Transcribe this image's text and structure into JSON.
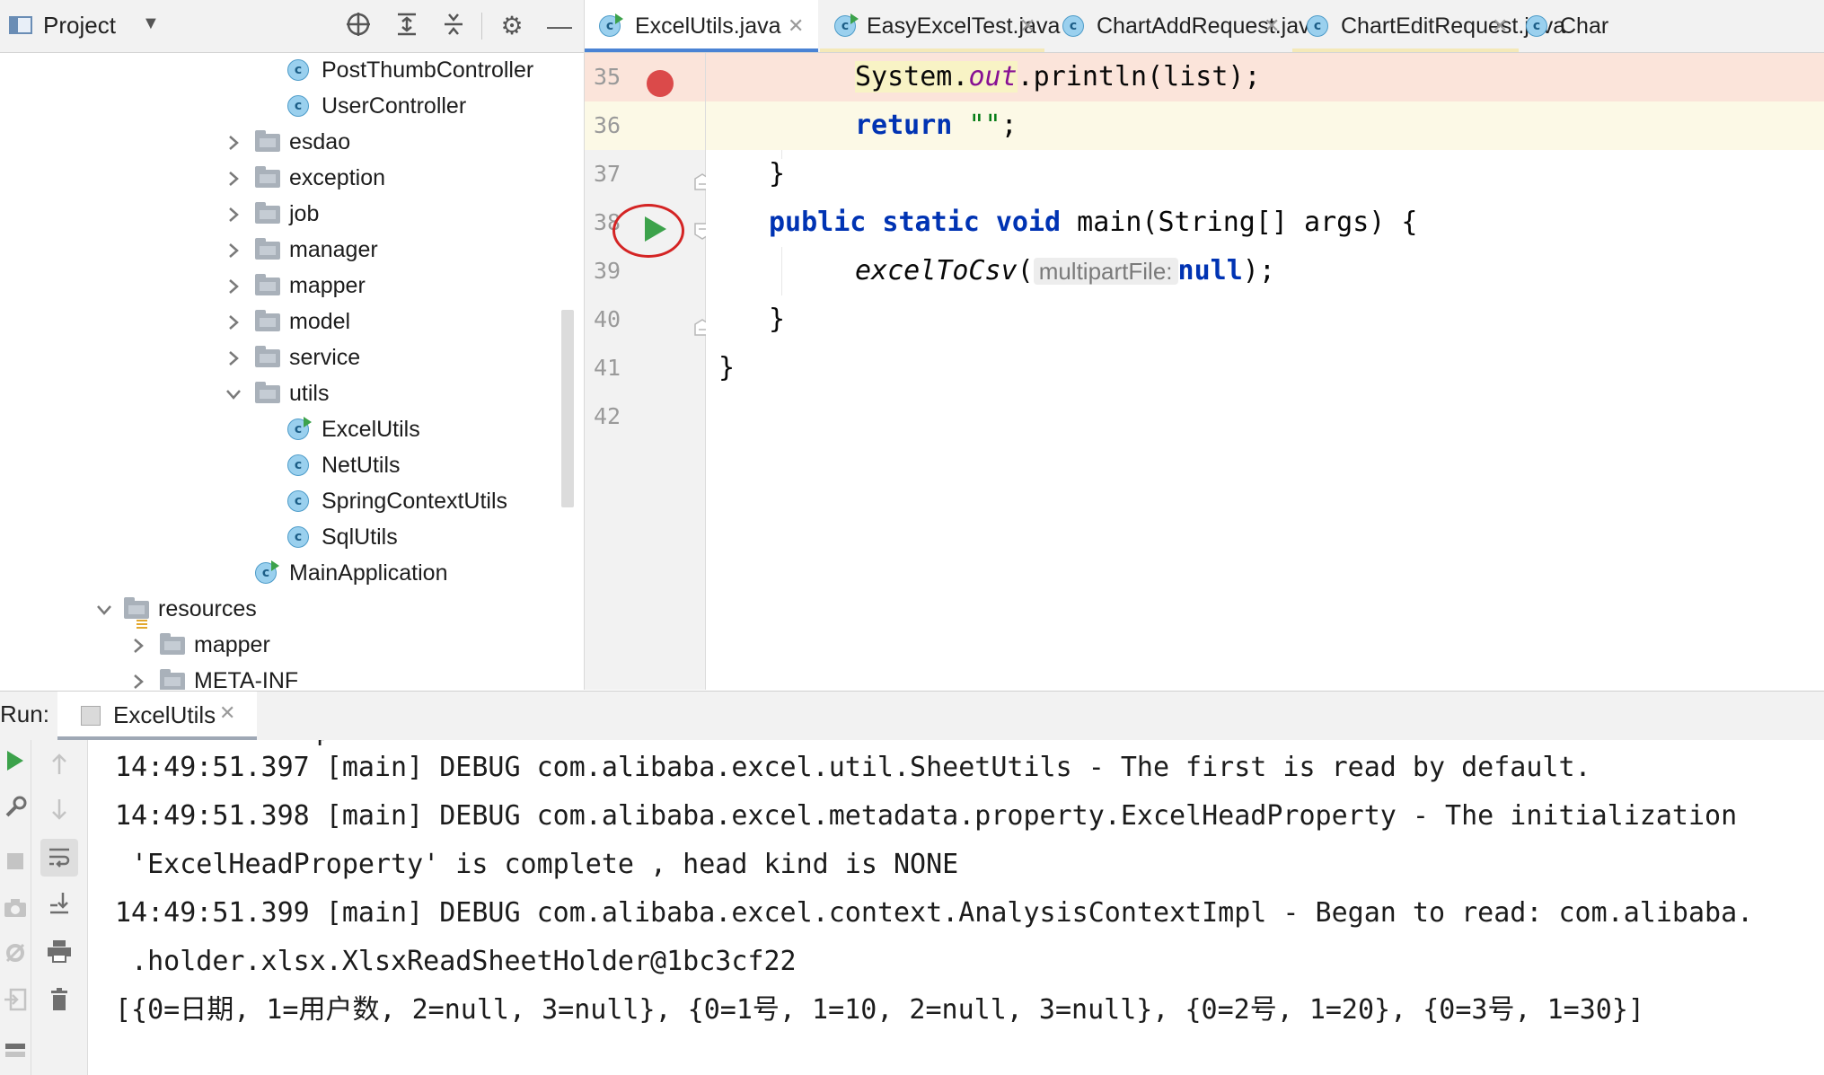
{
  "project_panel": {
    "title": "Project",
    "header_buttons": [
      "locate-icon",
      "expand-all-icon",
      "collapse-all-icon",
      "gear-icon",
      "minimize-icon"
    ],
    "tree": [
      {
        "label": "PostThumbController",
        "type": "class"
      },
      {
        "label": "UserController",
        "type": "class"
      },
      {
        "label": "esdao",
        "type": "package",
        "expanded": false
      },
      {
        "label": "exception",
        "type": "package",
        "expanded": false
      },
      {
        "label": "job",
        "type": "package",
        "expanded": false
      },
      {
        "label": "manager",
        "type": "package",
        "expanded": false
      },
      {
        "label": "mapper",
        "type": "package",
        "expanded": false
      },
      {
        "label": "model",
        "type": "package",
        "expanded": false
      },
      {
        "label": "service",
        "type": "package",
        "expanded": false
      },
      {
        "label": "utils",
        "type": "package",
        "expanded": true
      },
      {
        "label": "ExcelUtils",
        "type": "runnable-class"
      },
      {
        "label": "NetUtils",
        "type": "class"
      },
      {
        "label": "SpringContextUtils",
        "type": "class"
      },
      {
        "label": "SqlUtils",
        "type": "class"
      },
      {
        "label": "MainApplication",
        "type": "spring-class"
      },
      {
        "label": "resources",
        "type": "resources",
        "expanded": true
      },
      {
        "label": "mapper",
        "type": "folder",
        "expanded": false
      },
      {
        "label": "META-INF",
        "type": "folder",
        "expanded": false
      }
    ]
  },
  "editor": {
    "tabs": [
      {
        "label": "ExcelUtils.java",
        "active": true
      },
      {
        "label": "EasyExcelTest.java",
        "active": false
      },
      {
        "label": "ChartAddRequest.java",
        "active": false
      },
      {
        "label": "ChartEditRequest.java",
        "active": false
      },
      {
        "label": "Char",
        "active": false
      }
    ],
    "line_numbers": [
      "35",
      "36",
      "37",
      "38",
      "39",
      "40",
      "41",
      "42"
    ],
    "code": {
      "l35_a": "System.",
      "l35_b": "out",
      "l35_c": ".println(list);",
      "l36_kw": "return",
      "l36_str": "\"\"",
      "l36_end": ";",
      "l37": "}",
      "l38_kw": "public static void",
      "l38_rest": " main(String[] args) {",
      "l39_fn": "excelToCsv",
      "l39_open": "(",
      "l39_hint": "multipartFile:",
      "l39_kw": "null",
      "l39_end": ");",
      "l40": "}",
      "l41": "}"
    }
  },
  "run_panel": {
    "title": "Run:",
    "tab_label": "ExcelUtils",
    "console_lines": [
      "14:49:51.397 [main] DEBUG com.alibaba.excel.util.SheetUtils - The first is read by default.",
      "14:49:51.398 [main] DEBUG com.alibaba.excel.metadata.property.ExcelHeadProperty - The initialization",
      " 'ExcelHeadProperty' is complete , head kind is NONE",
      "14:49:51.399 [main] DEBUG com.alibaba.excel.context.AnalysisContextImpl - Began to read: com.alibaba.",
      " .holder.xlsx.XlsxReadSheetHolder@1bc3cf22",
      "[{0=日期, 1=用户数, 2=null, 3=null}, {0=1号, 1=10, 2=null, 3=null}, {0=2号, 1=20}, {0=3号, 1=30}]"
    ]
  },
  "colors": {
    "breakpoint": "#db4a4a",
    "run_gutter": "#3ca24b",
    "annotation_circle": "#d42424",
    "active_tab_underline": "#4a83d4",
    "keyword": "#0033b3",
    "string": "#067d17"
  }
}
